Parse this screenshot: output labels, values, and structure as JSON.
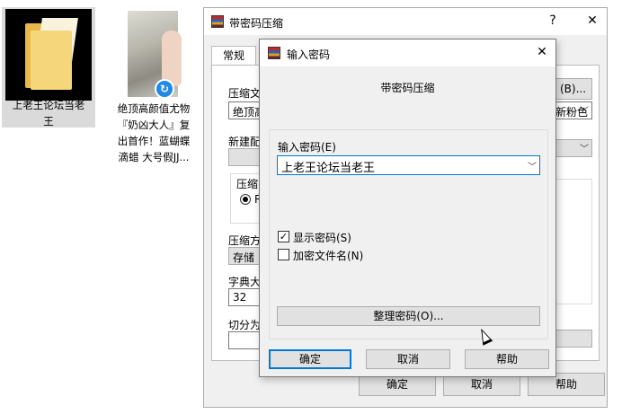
{
  "desktop": {
    "icons": [
      {
        "label_line1": "上老王论坛当老",
        "label_line2": "王",
        "icon": "folder-icon"
      },
      {
        "label_line1": "绝顶高颜值尤物",
        "label_line2": "『奶凶大人』复",
        "label_line3": "出首作！蓝蝴蝶",
        "label_line4": "滴蜡 大号假JJ...",
        "icon": "image-thumbnail"
      }
    ]
  },
  "outer_dialog": {
    "title": "带密码压缩",
    "help_btn": "?",
    "close_btn": "✕",
    "tab_general": "常规",
    "label_archive_name": "压缩文",
    "archive_name_value": "绝顶高",
    "browse_btn": "(B)...",
    "update_mode_value": "新粉色",
    "label_new_profile": "新建配",
    "label_compress_format": "压缩",
    "radio_rar": "R",
    "label_compress_method": "压缩方",
    "compress_method_value": "存储",
    "label_dict_size": "字典大",
    "dict_size_value": "32",
    "label_split_volume": "切分为",
    "ok_btn": "确定",
    "cancel_btn": "取消",
    "help_btn_bottom": "帮助"
  },
  "password_dialog": {
    "title": "输入密码",
    "close_btn": "✕",
    "heading": "带密码压缩",
    "label_password": "输入密码(E)",
    "password_value": "上老王论坛当老王",
    "show_password_label": "显示密码(S)",
    "show_password_checked": true,
    "encrypt_filenames_label": "加密文件名(N)",
    "encrypt_filenames_checked": false,
    "organize_btn": "整理密码(O)...",
    "ok_btn": "确定",
    "cancel_btn": "取消",
    "help_btn": "帮助",
    "check_mark": "✓"
  },
  "colors": {
    "default_button_border": "#0078d7",
    "dialog_background": "#f0f0f0"
  }
}
